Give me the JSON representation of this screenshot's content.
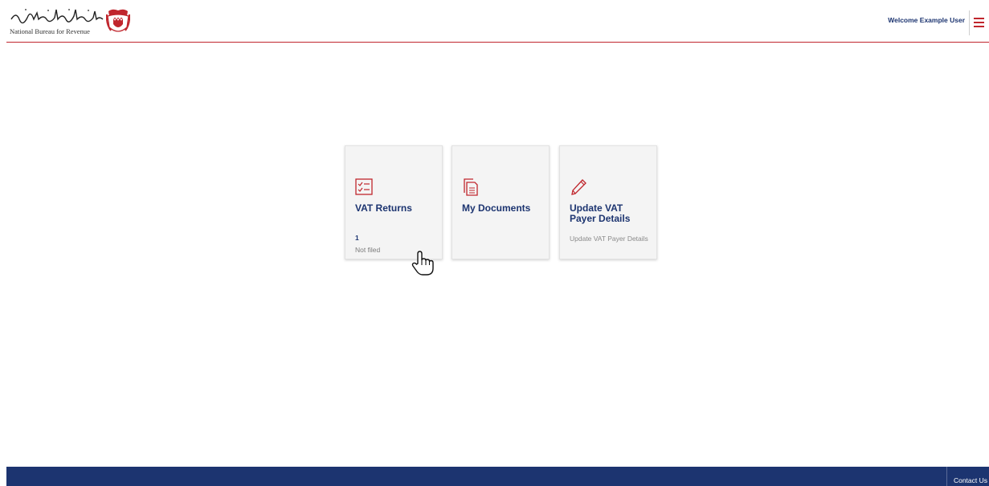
{
  "header": {
    "logo_arabic": "الجهاز الوطني للإيرادات",
    "logo_english": "National Bureau for Revenue",
    "welcome_text": "Welcome Example User",
    "menu_icon": "hamburger-menu-icon"
  },
  "cards": [
    {
      "title": "VAT Returns",
      "icon": "checklist-icon",
      "count": "1",
      "sub": "Not filed"
    },
    {
      "title": "My Documents",
      "icon": "documents-icon"
    },
    {
      "title": "Update VAT Payer Details",
      "icon": "pencil-icon",
      "description": "Update VAT Payer Details"
    }
  ],
  "footer": {
    "contact_label": "Contact Us"
  },
  "colors": {
    "brand_red": "#c0262d",
    "brand_navy": "#1c3470",
    "card_bg": "#f4f4f4"
  }
}
